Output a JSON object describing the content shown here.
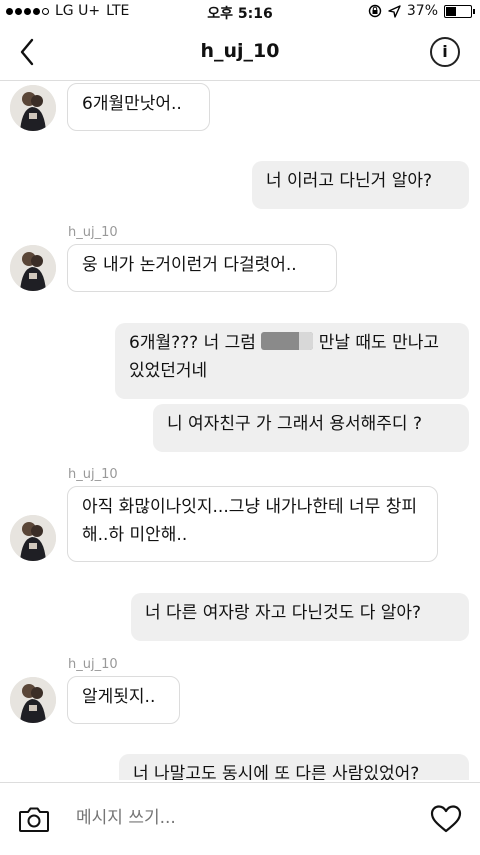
{
  "status_bar": {
    "carrier": "LG U+",
    "network": "LTE",
    "time": "오후 5:16",
    "battery": "37%",
    "battery_fraction": 0.37
  },
  "header": {
    "title": "h_uj_10"
  },
  "chat": {
    "sender_name": "h_uj_10",
    "messages": [
      {
        "side": "in",
        "text": "6개월만낫어.."
      },
      {
        "side": "out",
        "text": "너 이러고 다닌거 알아?"
      },
      {
        "side": "in",
        "sender": "h_uj_10",
        "text": "웅 내가 논거이런거 다걸렷어.."
      },
      {
        "side": "out",
        "text_before": "6개월??? 너 그럼",
        "text_after": "만날 때도 만나고 있었던거네"
      },
      {
        "side": "out",
        "text": "니 여자친구 가 그래서 용서해주디 ?"
      },
      {
        "side": "in",
        "sender": "h_uj_10",
        "text": "아직 화많이나잇지...그냥 내가나한테 너무 창피해..하 미안해.."
      },
      {
        "side": "out",
        "text": "너 다른 여자랑 자고 다닌것도 다 알아?"
      },
      {
        "side": "in",
        "sender": "h_uj_10",
        "text": "알게됫지.."
      },
      {
        "side": "out",
        "text": "너 나말고도 동시에 또 다른 사람있었어?"
      }
    ]
  },
  "composer": {
    "placeholder": "메시지 쓰기..."
  },
  "icons": {
    "back": "chevron-left-icon",
    "info": "info-icon",
    "camera": "camera-icon",
    "heart": "heart-icon",
    "location": "location-arrow-icon",
    "rotation_lock": "rotation-lock-icon"
  }
}
